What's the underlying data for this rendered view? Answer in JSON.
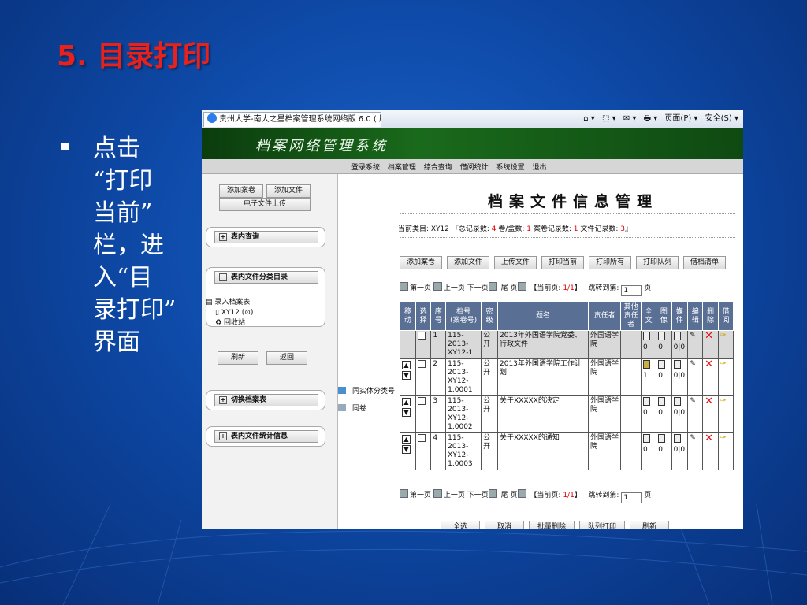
{
  "slide": {
    "title": "5. 目录打印",
    "bullet_lines": [
      "点击",
      "“打印",
      "当前”",
      "栏，进",
      "入“目",
      "录打印”",
      "界面"
    ]
  },
  "browser": {
    "tab_title": "贵州大学-南大之星档案管理系统网络版 6.0 ( 服...",
    "tools": [
      "⌂ ▾",
      "⬚ ▾",
      "✉ ▾",
      "🖶 ▾",
      "页面(P) ▾",
      "安全(S) ▾"
    ]
  },
  "app": {
    "banner_title": "档案网络管理系统",
    "nav": [
      "登录系统",
      "档案管理",
      "综合查询",
      "借阅统计",
      "系统设置",
      "退出"
    ]
  },
  "left": {
    "btn_add_volume": "添加案卷",
    "btn_add_file": "添加文件",
    "btn_upload": "电子文件上传",
    "panel_search": "表内查询",
    "panel_category": "表内文件分类目录",
    "tree": {
      "root": "录入档案表",
      "node": "XY12 (⊙)",
      "recycle": "回收站"
    },
    "btn_refresh": "刷新",
    "btn_back": "返回",
    "panel_switch": "切换档案表",
    "panel_stats": "表内文件统计信息"
  },
  "main": {
    "heading": "档案文件信息管理",
    "stats_prefix": "当前类目: XY12 『总记录数: ",
    "stats_total": "4",
    "stats_mid1": " 卷/盒数: ",
    "stats_boxes": "1",
    "stats_mid2": " 案卷记录数: ",
    "stats_vol": "1",
    "stats_mid3": " 文件记录数: ",
    "stats_files": "3",
    "stats_suffix": "』",
    "actions": [
      "添加案卷",
      "添加文件",
      "上传文件",
      "打印当前",
      "打印所有",
      "打印队列",
      "借档清单"
    ],
    "pager": {
      "first": "第一页",
      "prev": "上一页",
      "next": "下一页",
      "last": "尾 页",
      "current_label": "【当前页: ",
      "current_value": "1/1",
      "current_end": "】",
      "jump": "跳转到第: ",
      "jump_value": "1",
      "page": "页"
    },
    "side_links": [
      "同实体分类号",
      "同卷"
    ],
    "table": {
      "headers": [
        "移动",
        "选择",
        "序号",
        "档号\n(案卷号)",
        "密级",
        "题名",
        "责任者",
        "其他\n责任者",
        "全文",
        "图像",
        "媒件",
        "编辑",
        "删除",
        "借阅"
      ],
      "rows": [
        {
          "seq": "1",
          "code": "115-2013-XY12-1",
          "secret": "公开",
          "title": "2013年外国语学院党委、行政文件",
          "owner": "外国语学院",
          "other": "",
          "full": "0",
          "img": "0",
          "media": "0|0"
        },
        {
          "seq": "2",
          "code": "115-2013-XY12-1.0001",
          "secret": "公开",
          "title": "2013年外国语学院工作计划",
          "owner": "外国语学院",
          "other": "",
          "full": "1",
          "img": "0",
          "media": "0|0"
        },
        {
          "seq": "3",
          "code": "115-2013-XY12-1.0002",
          "secret": "公开",
          "title": "关于XXXXX的决定",
          "owner": "外国语学院",
          "other": "",
          "full": "0",
          "img": "0",
          "media": "0|0"
        },
        {
          "seq": "4",
          "code": "115-2013-XY12-1.0003",
          "secret": "公开",
          "title": "关于XXXXX的通知",
          "owner": "外国语学院",
          "other": "",
          "full": "0",
          "img": "0",
          "media": "0|0"
        }
      ]
    },
    "bottom_buttons": [
      "全选",
      "取消",
      "批量删除",
      "队列打印",
      "刷新"
    ]
  }
}
